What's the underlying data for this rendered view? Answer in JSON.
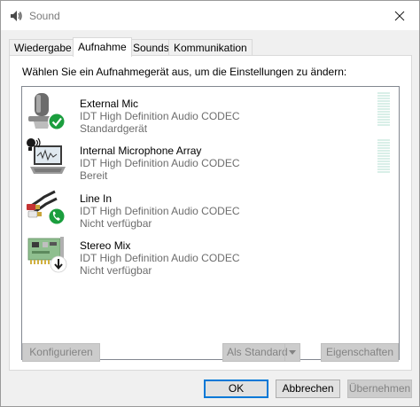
{
  "window": {
    "title": "Sound"
  },
  "tabs": [
    {
      "label": "Wiedergabe"
    },
    {
      "label": "Aufnahme"
    },
    {
      "label": "Sounds"
    },
    {
      "label": "Kommunikation"
    }
  ],
  "panel": {
    "instruction": "Wählen Sie ein Aufnahmegerät aus, um die Einstellungen zu ändern:"
  },
  "devices": [
    {
      "name": "External Mic",
      "driver": "IDT High Definition Audio CODEC",
      "status": "Standardgerät",
      "icon": "microphone-icon",
      "badge": "default-check-badge",
      "meter_level": 0
    },
    {
      "name": "Internal Microphone Array",
      "driver": "IDT High Definition Audio CODEC",
      "status": "Bereit",
      "icon": "laptop-microphone-icon",
      "meter_level": 0
    },
    {
      "name": "Line In",
      "driver": "IDT High Definition Audio CODEC",
      "status": "Nicht verfügbar",
      "icon": "rca-cable-icon",
      "badge": "phone-badge"
    },
    {
      "name": "Stereo Mix",
      "driver": "IDT High Definition Audio CODEC",
      "status": "Nicht verfügbar",
      "icon": "sound-card-icon",
      "badge": "down-arrow-badge"
    }
  ],
  "buttons": {
    "configure": "Konfigurieren",
    "set_default": "Als Standard",
    "properties": "Eigenschaften",
    "ok": "OK",
    "cancel": "Abbrechen",
    "apply": "Übernehmen"
  },
  "colors": {
    "badge_green": "#1b9e3e",
    "meter_color": "#d9efe8",
    "focus_blue": "#0078d7"
  }
}
